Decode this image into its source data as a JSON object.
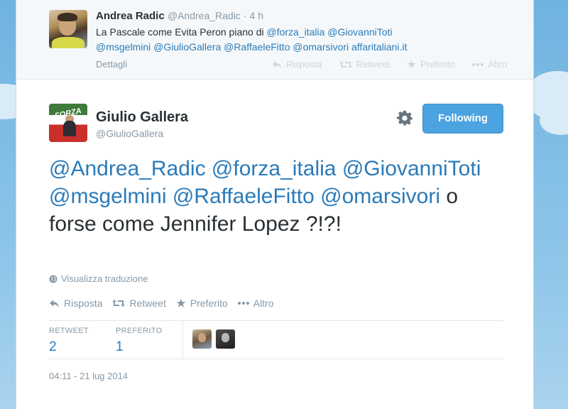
{
  "parent_tweet": {
    "author_name": "Andrea Radic",
    "author_handle": "@Andrea_Radic",
    "time": "· 4 h",
    "text_plain": "La Pascale come Evita Peron piano di ",
    "mentions_line1": [
      "@forza_italia",
      "@GiovanniToti"
    ],
    "mentions_line2": [
      "@msgelmini",
      "@GiulioGallera",
      "@RaffaeleFitto",
      "@omarsivori"
    ],
    "link": "affaritaliani.it",
    "details_label": "Dettagli",
    "actions": [
      {
        "icon": "reply-icon",
        "label": "Risposta"
      },
      {
        "icon": "retweet-icon",
        "label": "Retweet"
      },
      {
        "icon": "star-icon",
        "label": "Preferito"
      },
      {
        "icon": "more-icon",
        "label": "Altro"
      }
    ]
  },
  "main_tweet": {
    "author_name": "Giulio Gallera",
    "author_handle": "@GiulioGallera",
    "follow_label": "Following",
    "mentions": [
      "@Andrea_Radic",
      "@forza_italia",
      "@GiovanniToti",
      "@msgelmini",
      "@RaffaeleFitto",
      "@omarsivori"
    ],
    "text_tail": "o forse come Jennifer Lopez ?!?!",
    "translate_label": "Visualizza traduzione",
    "actions": [
      {
        "icon": "reply-icon",
        "label": "Risposta"
      },
      {
        "icon": "retweet-icon",
        "label": "Retweet"
      },
      {
        "icon": "star-icon",
        "label": "Preferito"
      },
      {
        "icon": "more-icon",
        "label": "Altro"
      }
    ],
    "stats": {
      "retweet_label": "RETWEET",
      "retweet_count": "2",
      "favorite_label": "PREFERITO",
      "favorite_count": "1"
    },
    "timestamp": "04:11 - 21 lug 2014"
  },
  "colors": {
    "link": "#2b7bb9",
    "follow_button": "#4ba3e0",
    "muted": "#8899a6",
    "background_sky": "#8cc4e8"
  }
}
